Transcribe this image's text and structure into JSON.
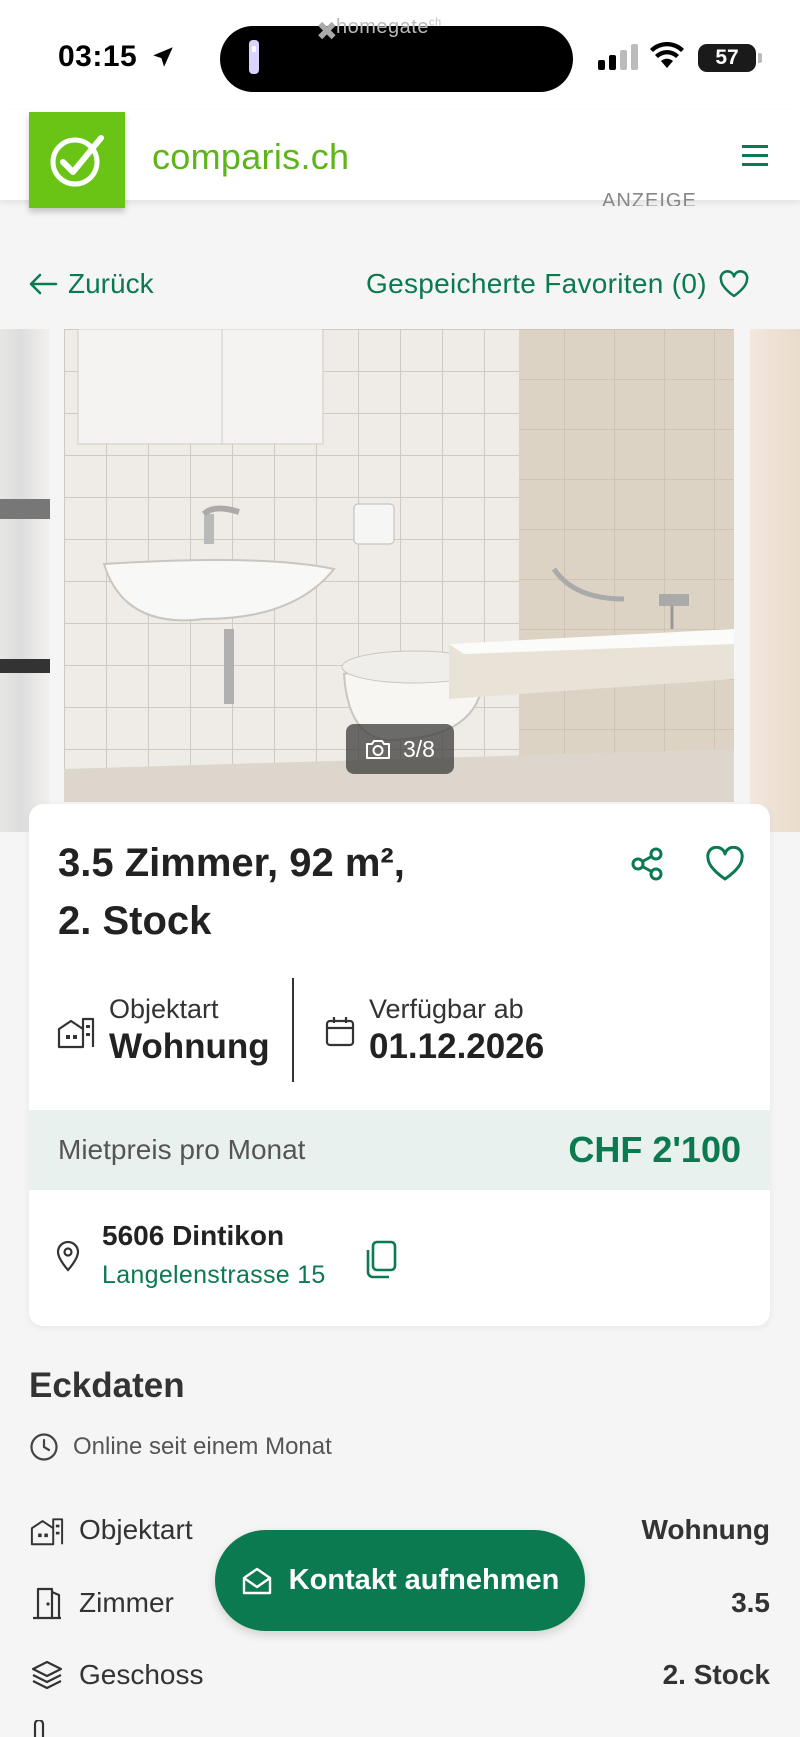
{
  "status_bar": {
    "time": "03:15",
    "island_app": "homegate",
    "island_app_suffix": "ch",
    "battery": "57"
  },
  "header": {
    "brand": "comparis.ch",
    "ad_label": "ANZEIGE"
  },
  "nav": {
    "back_label": "Zurück",
    "favorites_label": "Gespeicherte Favoriten (0)"
  },
  "gallery": {
    "counter": "3/8"
  },
  "listing": {
    "title_line1": "3.5 Zimmer, 92 m²,",
    "title_line2": "2. Stock",
    "object_type_label": "Objektart",
    "object_type_value": "Wohnung",
    "available_label": "Verfügbar ab",
    "available_value": "01.12.2026",
    "price_label": "Mietpreis pro Monat",
    "price_value": "CHF 2'100",
    "city": "5606 Dintikon",
    "street": "Langelenstrasse 15"
  },
  "details": {
    "title": "Eckdaten",
    "online_since": "Online seit einem Monat",
    "rows": [
      {
        "label": "Objektart",
        "value": "Wohnung",
        "icon": "building-icon"
      },
      {
        "label": "Zimmer",
        "value": "3.5",
        "icon": "door-icon"
      },
      {
        "label": "Geschoss",
        "value": "2. Stock",
        "icon": "layers-icon"
      }
    ]
  },
  "cta": {
    "label": "Kontakt aufnehmen"
  },
  "colors": {
    "brand_green": "#6ac415",
    "accent_green": "#0b7a50",
    "price_bg": "#e8f1ee"
  }
}
